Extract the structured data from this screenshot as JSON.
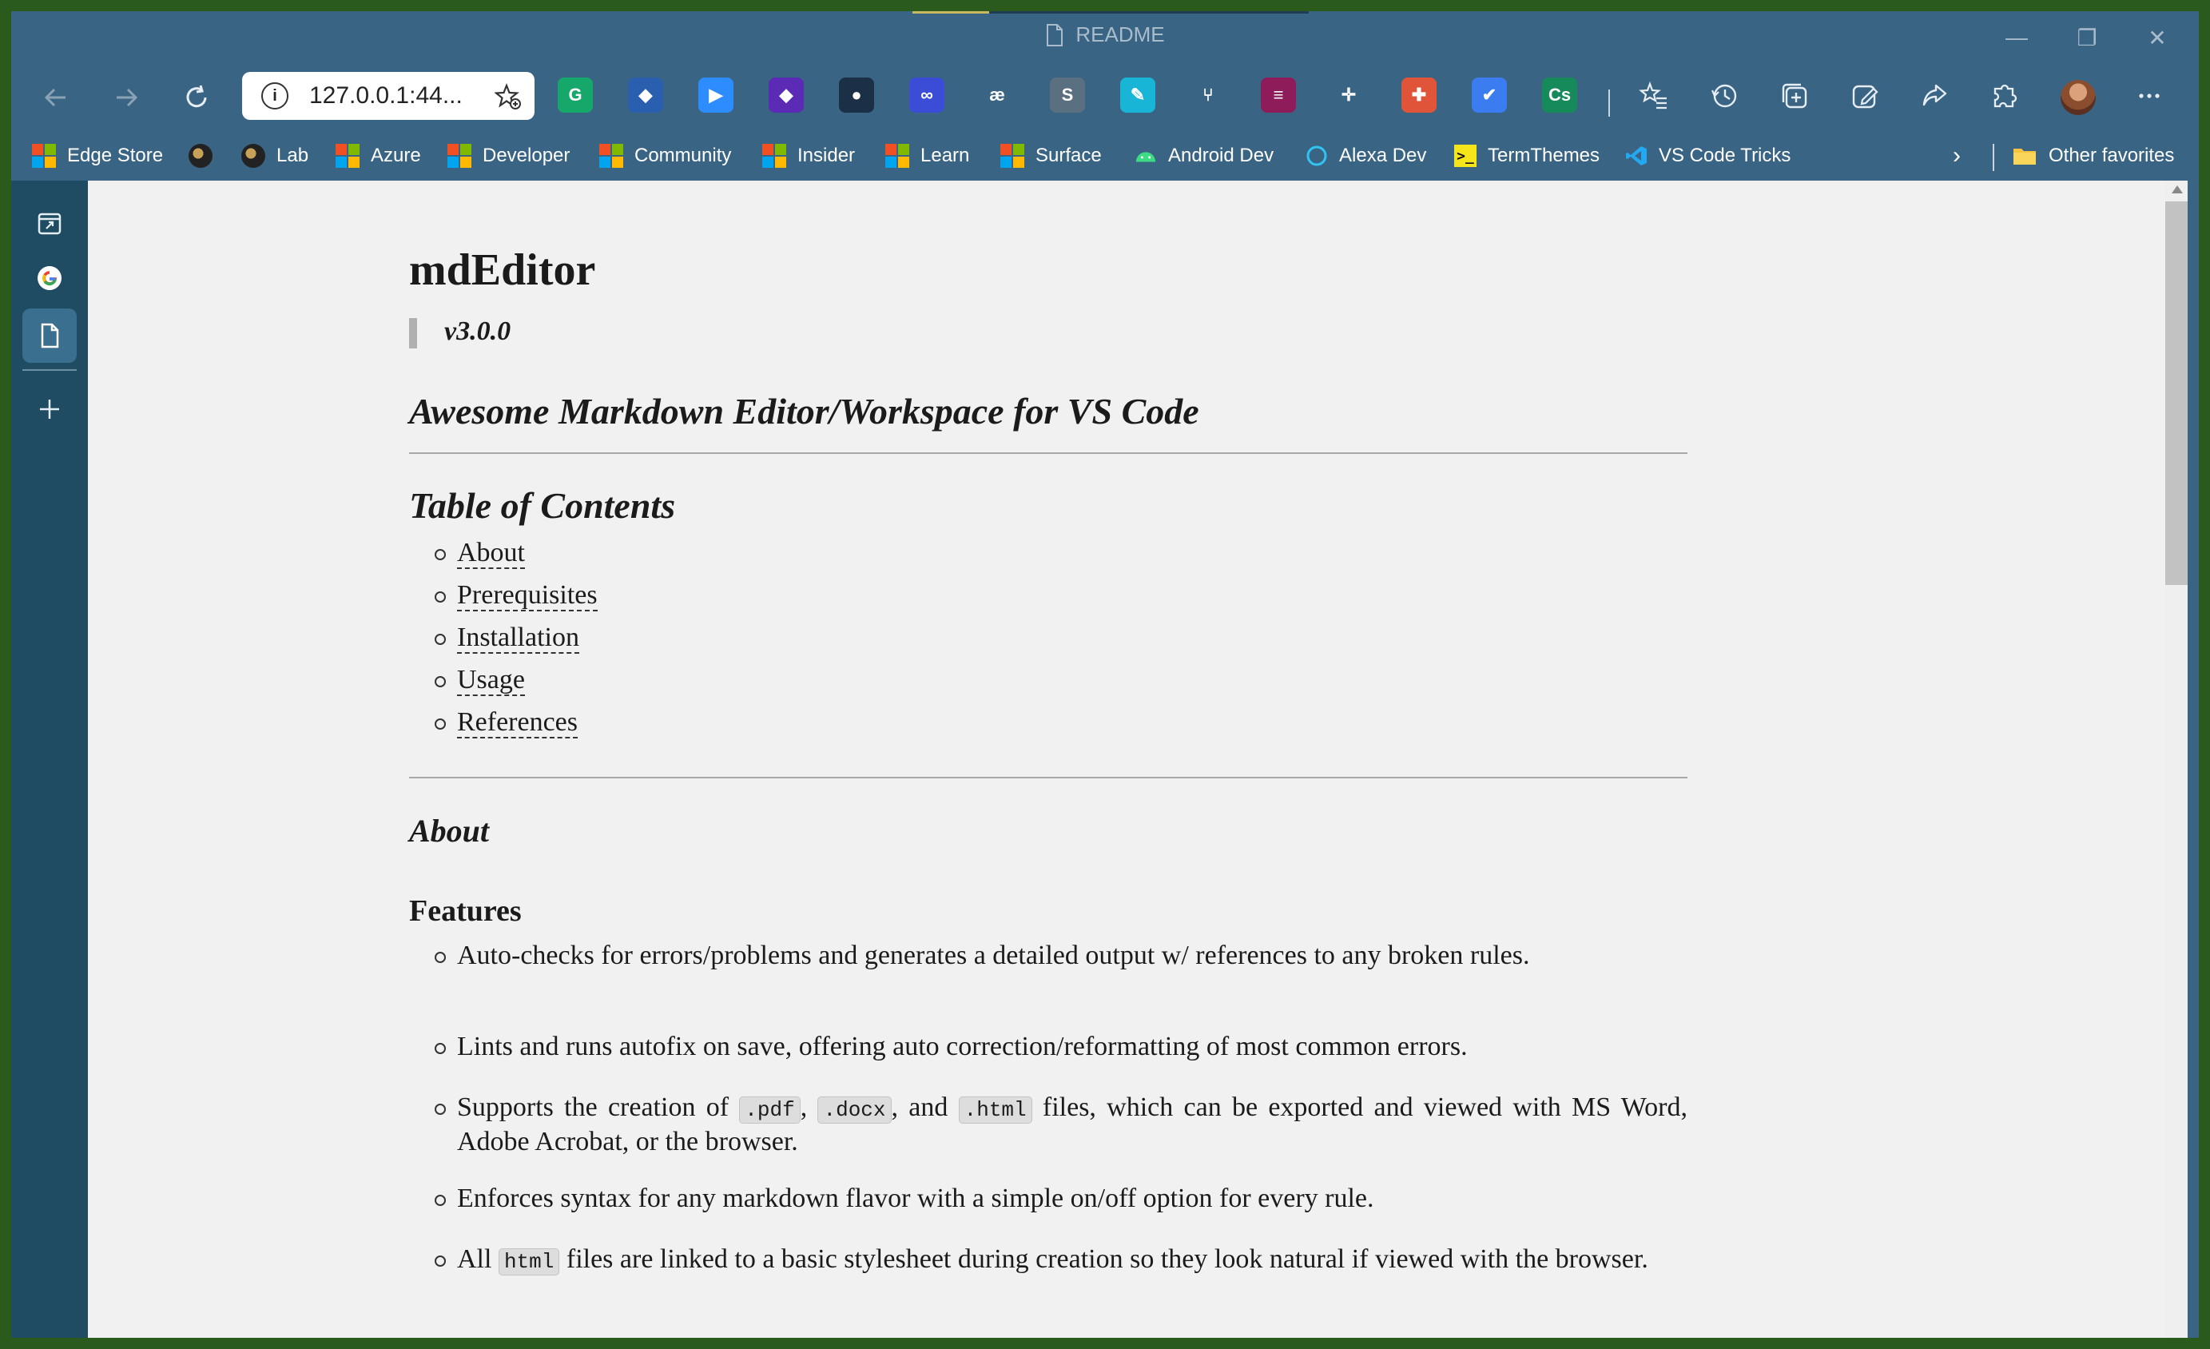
{
  "window": {
    "title": "README"
  },
  "toolbar": {
    "address": "127.0.0.1:44..."
  },
  "extensions": [
    {
      "name": "grammarly-icon",
      "glyph": "G",
      "bg": "#15a86a"
    },
    {
      "name": "ext-blue-icon",
      "glyph": "◆",
      "bg": "#2a5fb0"
    },
    {
      "name": "zoom-icon",
      "glyph": "▶",
      "bg": "#2d8cff"
    },
    {
      "name": "ext-purple-icon",
      "glyph": "◆",
      "bg": "#5b2bb5"
    },
    {
      "name": "ext-chat-icon",
      "glyph": "●",
      "bg": "#1b2f46"
    },
    {
      "name": "ext-link-icon",
      "glyph": "∞",
      "bg": "#3b4dd6"
    },
    {
      "name": "ae-icon",
      "glyph": "æ",
      "bg": "#3a6484"
    },
    {
      "name": "ext-s-icon",
      "glyph": "S",
      "bg": "#5a6f80"
    },
    {
      "name": "ext-pen-icon",
      "glyph": "✎",
      "bg": "#19b5d6"
    },
    {
      "name": "ext-fork-icon",
      "glyph": "⑂",
      "bg": "#3a6484"
    },
    {
      "name": "ext-pink-icon",
      "glyph": "≡",
      "bg": "#8e1c5a"
    },
    {
      "name": "ext-cross-icon",
      "glyph": "✛",
      "bg": "#3a6484"
    },
    {
      "name": "ext-red-icon",
      "glyph": "✚",
      "bg": "#e0553a"
    },
    {
      "name": "ext-check-icon",
      "glyph": "✔",
      "bg": "#3b7cf0"
    },
    {
      "name": "ext-cs-icon",
      "glyph": "Cs",
      "bg": "#178a5b"
    }
  ],
  "favorites": [
    {
      "label": "Edge Store",
      "icon": "ms"
    },
    {
      "label": "",
      "icon": "globe"
    },
    {
      "label": "Lab",
      "icon": "globe"
    },
    {
      "label": "Azure",
      "icon": "ms"
    },
    {
      "label": "Developer",
      "icon": "ms"
    },
    {
      "label": "Community",
      "icon": "ms"
    },
    {
      "label": "Insider",
      "icon": "ms"
    },
    {
      "label": "Learn",
      "icon": "ms"
    },
    {
      "label": "Surface",
      "icon": "ms"
    },
    {
      "label": "Android Dev",
      "icon": "android"
    },
    {
      "label": "Alexa Dev",
      "icon": "alexa"
    },
    {
      "label": "TermThemes",
      "icon": "term"
    },
    {
      "label": "VS Code Tricks",
      "icon": "vscode"
    }
  ],
  "other_favorites": "Other favorites",
  "doc": {
    "title": "mdEditor",
    "version": "v3.0.0",
    "tagline": "Awesome Markdown Editor/Workspace for VS Code",
    "toc_title": "Table of Contents",
    "toc": [
      "About",
      "Prerequisites",
      "Installation",
      "Usage",
      "References"
    ],
    "about_heading": "About",
    "features_heading": "Features",
    "features": {
      "f1": "Auto-checks for errors/problems and generates a detailed output w/ references to any broken rules.",
      "f2": "Lints and runs autofix on save, offering auto correction/reformatting of most common errors.",
      "f3_a": "Supports the creation of ",
      "f3_code1": ".pdf",
      "f3_b": ", ",
      "f3_code2": ".docx",
      "f3_c": ", and ",
      "f3_code3": ".html",
      "f3_d": " files, which can be exported and viewed with MS Word, Adobe Acrobat, or the browser.",
      "f4": "Enforces syntax for any markdown flavor with a simple on/off option for every rule.",
      "f5_a": "All ",
      "f5_code": "html",
      "f5_b": " files are linked to a basic stylesheet during creation so they look natural if viewed with the browser."
    }
  }
}
